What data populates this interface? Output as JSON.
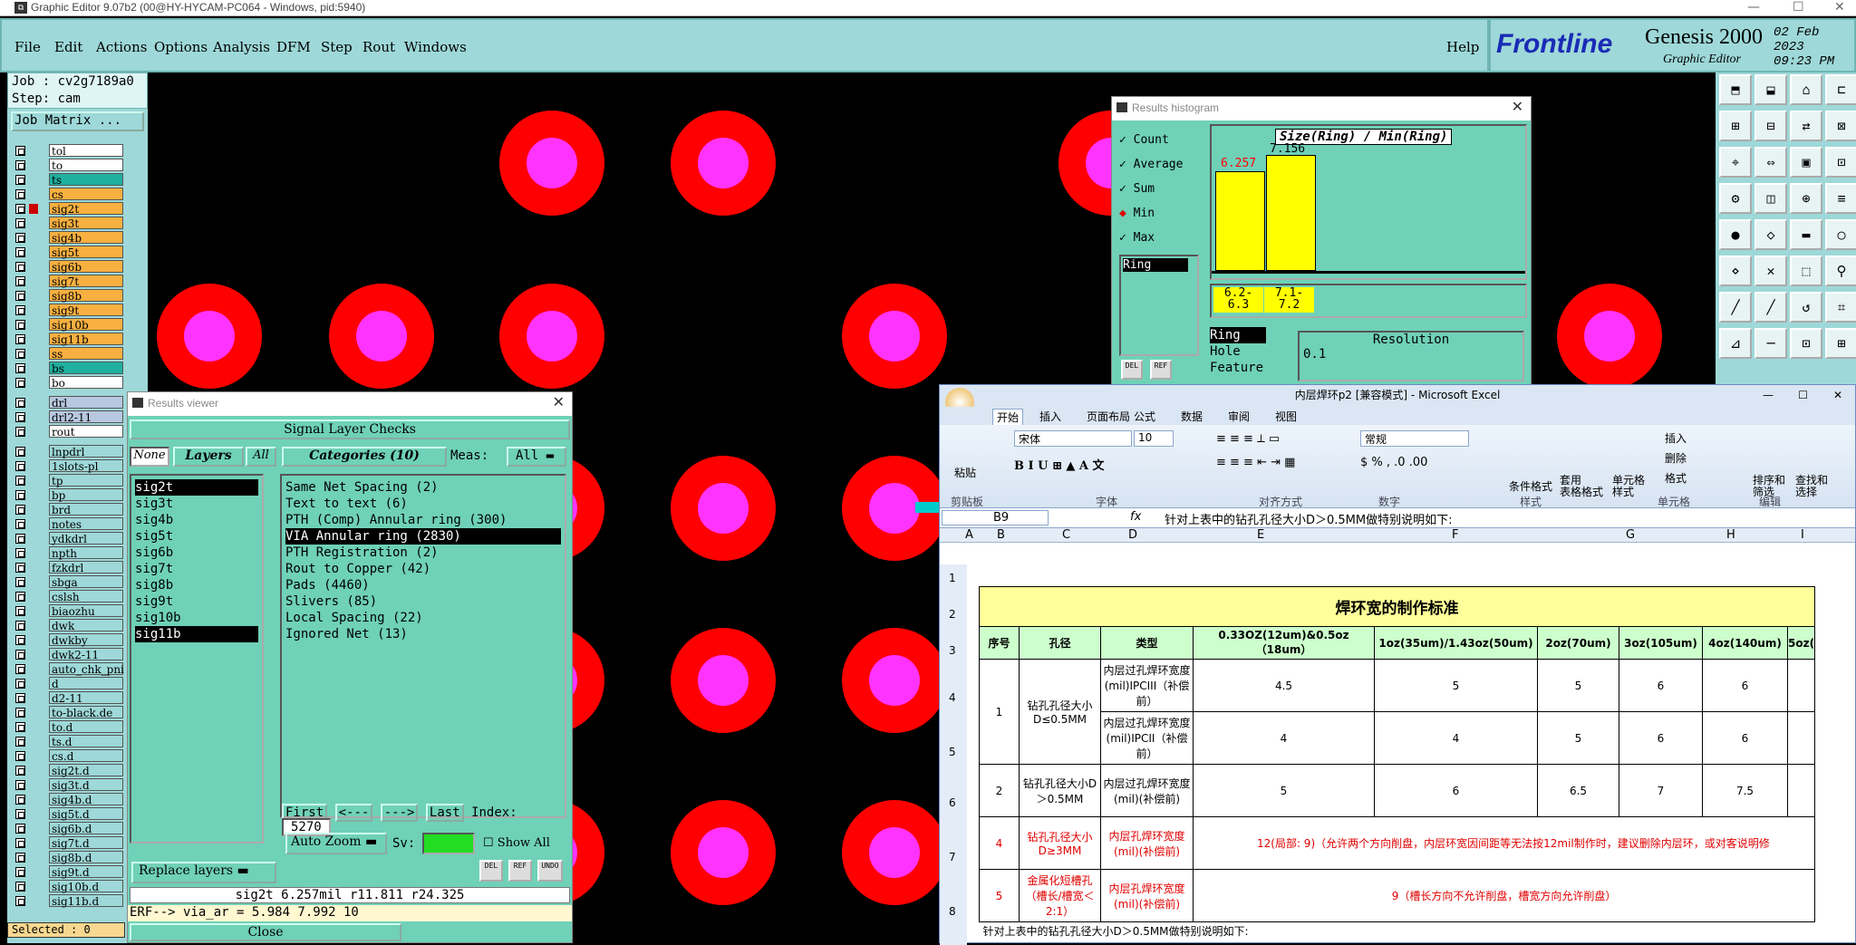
{
  "titlebar": {
    "title": "Graphic Editor 9.07b2 (00@HY-HYCAM-PC064 - Windows, pid:5940)"
  },
  "menu": [
    "File",
    "Edit",
    "Actions",
    "Options",
    "Analysis",
    "DFM",
    "Step",
    "Rout",
    "Windows"
  ],
  "help": "Help",
  "logo": {
    "brand": "Frontline",
    "product": "Genesis 2000",
    "sub": "Graphic Editor",
    "date": "02 Feb",
    "year": "2023",
    "time": "09:23 PM"
  },
  "job": {
    "job": "Job : cv2g7189a0",
    "step": "Step: cam",
    "matrix_btn": "Job Matrix ..."
  },
  "layers": [
    {
      "name": "tol",
      "color": "#ffffff"
    },
    {
      "name": "to",
      "color": "#ffffff"
    },
    {
      "name": "ts",
      "color": "#20b0a0"
    },
    {
      "name": "cs",
      "color": "#f8b040"
    },
    {
      "name": "sig2t",
      "color": "#f8b040"
    },
    {
      "name": "sig3t",
      "color": "#f8b040"
    },
    {
      "name": "sig4b",
      "color": "#f8b040"
    },
    {
      "name": "sig5t",
      "color": "#f8b040"
    },
    {
      "name": "sig6b",
      "color": "#f8b040"
    },
    {
      "name": "sig7t",
      "color": "#f8b040"
    },
    {
      "name": "sig8b",
      "color": "#f8b040"
    },
    {
      "name": "sig9t",
      "color": "#f8b040"
    },
    {
      "name": "sig10b",
      "color": "#f8b040"
    },
    {
      "name": "sig11b",
      "color": "#f8b040"
    },
    {
      "name": "ss",
      "color": "#f8b040"
    },
    {
      "name": "bs",
      "color": "#20b0a0"
    },
    {
      "name": "bo",
      "color": "#ffffff"
    }
  ],
  "layers2": [
    "drl",
    "drl2-11",
    "rout"
  ],
  "layers3": [
    "lnpdrl",
    "1slots-pl",
    "tp",
    "bp",
    "brd",
    "notes",
    "ydkdrl",
    "npth",
    "fzkdrl",
    "sbga",
    "cslsh",
    "biaozhu",
    "dwk",
    "dwkby",
    "dwk2-11",
    "auto_chk_pni",
    "d",
    "d2-11",
    "to-black.de",
    "to.d",
    "ts.d",
    "cs.d",
    "sig2t.d",
    "sig3t.d",
    "sig4b.d",
    "sig5t.d",
    "sig6b.d",
    "sig7t.d",
    "sig8b.d",
    "sig9t.d",
    "sig10b.d",
    "sig11b.d"
  ],
  "selected": "Selected : 0",
  "results_viewer": {
    "title": "Results viewer",
    "header": "Signal Layer Checks",
    "none": "None",
    "layers": "Layers",
    "all": "All",
    "categories_btn": "Categories (10)",
    "meas": "Meas:",
    "meas_val": "All",
    "layer_list": [
      "sig2t",
      "sig3t",
      "sig4b",
      "sig5t",
      "sig6b",
      "sig7t",
      "sig8b",
      "sig9t",
      "sig10b",
      "sig11b"
    ],
    "categories": [
      "Same Net Spacing (2)",
      "Text to text (6)",
      "PTH (Comp) Annular ring (300)",
      "VIA Annular ring (2830)",
      "PTH Registration (2)",
      "Rout to Copper (42)",
      "Pads (4460)",
      "Slivers (85)",
      "Local Spacing (22)",
      "Ignored Net (13)"
    ],
    "first": "First",
    "prev": "<---",
    "next": "--->",
    "last": "Last",
    "index_label": "Index:",
    "index": "5270",
    "replace": "Replace layers",
    "autozoom": "Auto Zoom",
    "sv": "Sv:",
    "showall": "Show All",
    "status": "sig2t  6.257mil   r11.811  r24.325",
    "close": "Close",
    "del": "DEL",
    "ref": "REF",
    "undo": "UNDO"
  },
  "erf": "ERF--> via_ar = 5.984 7.992 10",
  "histogram": {
    "title": "Results histogram",
    "options": [
      "Count",
      "Average",
      "Sum",
      "Min",
      "Max"
    ],
    "selected_option": "Min",
    "list_item": "Ring",
    "chart_title": "Size(Ring) / Min(Ring)",
    "bars": [
      {
        "label": "6.2- 6.3",
        "value": "6.257"
      },
      {
        "label": "7.1- 7.2",
        "value": "7.156"
      }
    ],
    "measures": [
      "Ring",
      "Hole",
      "Feature"
    ],
    "resolution_label": "Resolution",
    "resolution": "0.1"
  },
  "excel": {
    "title": "内层焊环p2  [兼容模式] - Microsoft Excel",
    "tabs": [
      "开始",
      "插入",
      "页面布局",
      "公式",
      "数据",
      "审阅",
      "视图"
    ],
    "font": "宋体",
    "size": "10",
    "numfmt": "常规",
    "groups": [
      "剪贴板",
      "字体",
      "对齐方式",
      "数字",
      "样式",
      "单元格",
      "编辑"
    ],
    "paste": "粘贴",
    "style_btns": [
      "条件格式",
      "套用\n表格格式",
      "单元格\n样式"
    ],
    "cell_btns": [
      "插入",
      "删除",
      "格式"
    ],
    "edit_btns": [
      "排序和\n筛选",
      "查找和\n选择"
    ],
    "namebox": "B9",
    "formula": "针对上表中的钻孔孔径大小D＞0.5MM做特别说明如下:",
    "cols": [
      "A",
      "B",
      "C",
      "D",
      "E",
      "F",
      "G",
      "H",
      "I"
    ],
    "rows": [
      "1",
      "2",
      "3",
      "4",
      "5",
      "6",
      "7",
      "8"
    ],
    "sheet_title": "焊环宽的制作标准",
    "headers": [
      "序号",
      "孔径",
      "类型",
      "0.33OZ(12um)&0.5oz（18um）",
      "1oz(35um)/1.43oz(50um)",
      "2oz(70um)",
      "3oz(105um)",
      "4oz(140um)",
      "5oz("
    ],
    "r1": {
      "no": "1",
      "hole": "钻孔孔径大小D≤0.5MM",
      "t1": "内层过孔焊环宽度(mil)IPCIII（补偿前）",
      "v1": [
        "4.5",
        "5",
        "5",
        "6",
        "6"
      ],
      "t2": "内层过孔焊环宽度(mil)IPCII（补偿前）",
      "v2": [
        "4",
        "4",
        "5",
        "6",
        "6"
      ]
    },
    "r2": {
      "no": "2",
      "hole": "钻孔孔径大小D＞0.5MM",
      "type": "内层过孔焊环宽度(mil)(补偿前)",
      "v": [
        "5",
        "6",
        "6.5",
        "7",
        "7.5"
      ]
    },
    "r4": {
      "no": "4",
      "hole": "钻孔孔径大小D≥3MM",
      "type": "内层孔焊环宽度(mil)(补偿前)",
      "note": "12(局部: 9)（允许两个方向削盘，内层环宽因间距等无法按12mil制作时，建议删除内层环，或对客说明修"
    },
    "r5": {
      "no": "5",
      "hole": "金属化短槽孔（槽长/槽宽＜2:1）",
      "type": "内层孔焊环宽度(mil)(补偿前)",
      "note": "9（槽长方向不允许削盘，槽宽方向允许削盘）"
    },
    "r9": "针对上表中的钻孔孔径大小D＞0.5MM做特别说明如下:"
  }
}
